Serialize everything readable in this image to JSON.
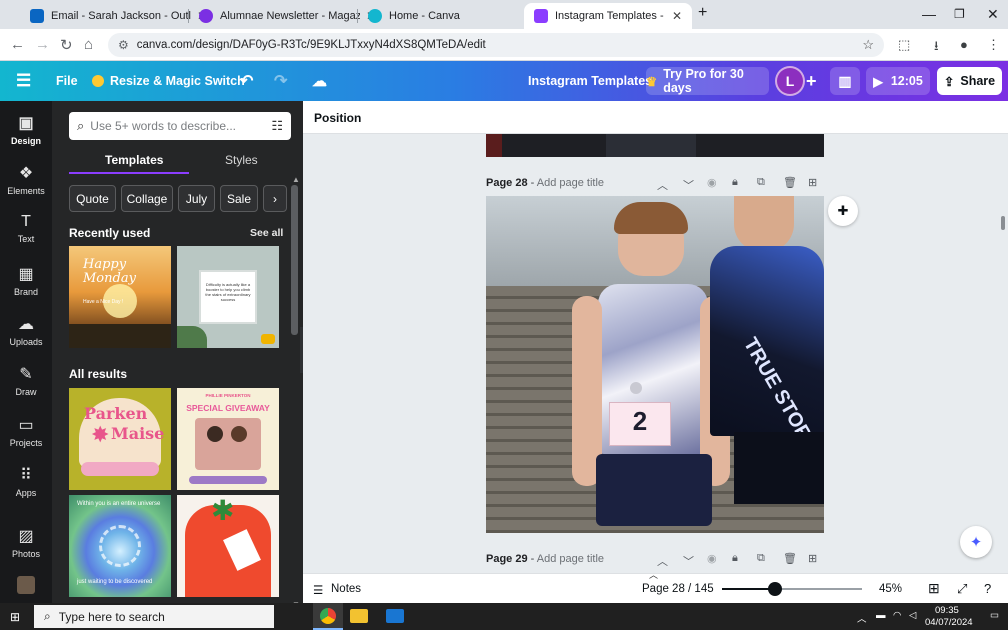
{
  "browser": {
    "tabs": [
      {
        "title": "Email - Sarah Jackson - Outlook",
        "color": "#0a66c2"
      },
      {
        "title": "Alumnae Newsletter - Magazine",
        "color": "#7b2fe3"
      },
      {
        "title": "Home - Canva",
        "color": "#13b6cf"
      },
      {
        "title": "Instagram Templates - Instagram",
        "color": "#8b3dff"
      }
    ],
    "new_tab": "+",
    "url": "canva.com/design/DAF0yG-R3Tc/9E9KLJTxxyN4dXS8QMTeDA/edit"
  },
  "topbar": {
    "menu_icon": "hamburger-icon",
    "file": "File",
    "resize": "Resize & Magic Switch",
    "title": "Instagram Templates",
    "try_pro": "Try Pro for 30 days",
    "avatar_letter": "L",
    "timer": "12:05",
    "share": "Share"
  },
  "rail": [
    {
      "label": "Design",
      "icon": "design-icon"
    },
    {
      "label": "Elements",
      "icon": "elements-icon"
    },
    {
      "label": "Text",
      "icon": "text-icon"
    },
    {
      "label": "Brand",
      "icon": "brand-icon"
    },
    {
      "label": "Uploads",
      "icon": "uploads-icon"
    },
    {
      "label": "Draw",
      "icon": "draw-icon"
    },
    {
      "label": "Projects",
      "icon": "projects-icon"
    },
    {
      "label": "Apps",
      "icon": "apps-icon"
    },
    {
      "label": "Photos",
      "icon": "photos-icon"
    }
  ],
  "panel": {
    "search_placeholder": "Use 5+ words to describe...",
    "tabs": [
      "Templates",
      "Styles"
    ],
    "chips": [
      "Quote",
      "Collage",
      "July",
      "Sale"
    ],
    "recently_used": "Recently used",
    "see_all": "See all",
    "all_results": "All results",
    "thumbs": {
      "happy_monday": {
        "line1": "Happy",
        "line2": "Monday",
        "sub": "Have a Nice Day !"
      },
      "quote": "Difficulty is actually like a booster to help you climb the stairs of extraordinary success",
      "parken": {
        "line1": "Parken",
        "line2": "Maise"
      },
      "giveaway": {
        "tag": "PHILLIE PINKERTON",
        "title": "SPECIAL GIVEAWAY"
      },
      "universe": {
        "top": "Within you is an entire universe",
        "bottom": "just waiting to be discovered"
      }
    }
  },
  "canvas": {
    "context": "Position",
    "page28": {
      "label": "Page 28",
      "add_title": "Add page title"
    },
    "page29": {
      "label": "Page 29",
      "add_title": "Add page title"
    },
    "bib_number": "2",
    "shirt_text": "TRUE STORY"
  },
  "status": {
    "notes": "Notes",
    "page_indicator": "Page 28 / 145",
    "zoom": "45%",
    "zoom_fraction": 0.38
  },
  "taskbar": {
    "search": "Type here to search",
    "time": "09:35",
    "date": "04/07/2024"
  }
}
